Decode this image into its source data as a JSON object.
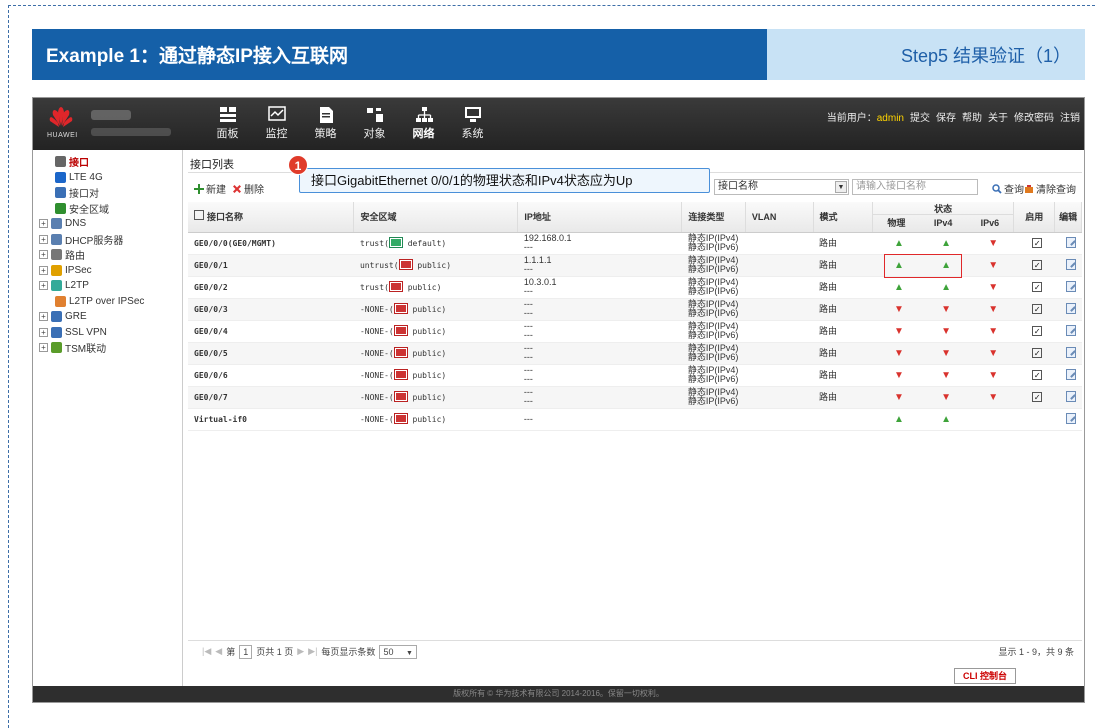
{
  "banner": {
    "title": "Example 1：通过静态IP接入互联网",
    "step": "Step5 结果验证（1）"
  },
  "app": {
    "brand": "HUAWEI",
    "nav": [
      {
        "label": "面板",
        "icon": "dashboard-icon"
      },
      {
        "label": "监控",
        "icon": "monitor-icon"
      },
      {
        "label": "策略",
        "icon": "policy-icon"
      },
      {
        "label": "对象",
        "icon": "object-icon"
      },
      {
        "label": "网络",
        "icon": "network-icon"
      },
      {
        "label": "系统",
        "icon": "system-icon"
      }
    ],
    "toplinks": {
      "user_prefix": "当前用户：",
      "user": "admin",
      "submit": "提交",
      "save": "保存",
      "help": "帮助",
      "about": "关于",
      "change_password": "修改密码",
      "logout": "注销"
    },
    "sidebar": [
      {
        "label": "接口",
        "active": true,
        "expand": false
      },
      {
        "label": "LTE 4G",
        "active": false,
        "expand": false
      },
      {
        "label": "接口对",
        "active": false,
        "expand": false
      },
      {
        "label": "安全区域",
        "active": false,
        "expand": false
      },
      {
        "label": "DNS",
        "active": false,
        "expand": true
      },
      {
        "label": "DHCP服务器",
        "active": false,
        "expand": true
      },
      {
        "label": "路由",
        "active": false,
        "expand": true
      },
      {
        "label": "IPSec",
        "active": false,
        "expand": true
      },
      {
        "label": "L2TP",
        "active": false,
        "expand": true
      },
      {
        "label": "L2TP over IPSec",
        "active": false,
        "expand": false
      },
      {
        "label": "GRE",
        "active": false,
        "expand": true
      },
      {
        "label": "SSL VPN",
        "active": false,
        "expand": true
      },
      {
        "label": "TSM联动",
        "active": false,
        "expand": true
      }
    ],
    "panel_title": "接口列表",
    "toolbar": {
      "new": "新建",
      "delete": "删除",
      "select_value": "接口名称",
      "search_placeholder": "请输入接口名称",
      "query": "查询",
      "clear": "清除查询"
    },
    "callout": {
      "num": "1",
      "text": "接口GigabitEthernet 0/0/1的物理状态和IPv4状态应为Up"
    },
    "columns": {
      "name": "接口名称",
      "zone": "安全区域",
      "ip": "IP地址",
      "conn": "连接类型",
      "vlan": "VLAN",
      "mode": "模式",
      "status": "状态",
      "phys": "物理",
      "ipv4": "IPv4",
      "ipv6": "IPv6",
      "enable": "启用",
      "edit": "编辑"
    },
    "rows": [
      {
        "name": "GE0/0/0(GE0/MGMT)",
        "zone_a": "trust(",
        "zone_b": " default)",
        "zone_color": "green",
        "ip1": "192.168.0.1",
        "ip2": "---",
        "conn1": "静态IP(IPv4)",
        "conn2": "静态IP(IPv6)",
        "mode": "路由",
        "phys": "up",
        "ipv4": "up",
        "ipv6": "down",
        "enable": true
      },
      {
        "name": "GE0/0/1",
        "zone_a": "untrust(",
        "zone_b": " public)",
        "zone_color": "red",
        "ip1": "1.1.1.1",
        "ip2": "---",
        "conn1": "静态IP(IPv4)",
        "conn2": "静态IP(IPv6)",
        "mode": "路由",
        "phys": "up",
        "ipv4": "up",
        "ipv6": "down",
        "enable": true
      },
      {
        "name": "GE0/0/2",
        "zone_a": "trust(",
        "zone_b": " public)",
        "zone_color": "red",
        "ip1": "10.3.0.1",
        "ip2": "---",
        "conn1": "静态IP(IPv4)",
        "conn2": "静态IP(IPv6)",
        "mode": "路由",
        "phys": "up",
        "ipv4": "up",
        "ipv6": "down",
        "enable": true
      },
      {
        "name": "GE0/0/3",
        "zone_a": "-NONE-(",
        "zone_b": " public)",
        "zone_color": "red",
        "ip1": "---",
        "ip2": "---",
        "conn1": "静态IP(IPv4)",
        "conn2": "静态IP(IPv6)",
        "mode": "路由",
        "phys": "down",
        "ipv4": "down",
        "ipv6": "down",
        "enable": true
      },
      {
        "name": "GE0/0/4",
        "zone_a": "-NONE-(",
        "zone_b": " public)",
        "zone_color": "red",
        "ip1": "---",
        "ip2": "---",
        "conn1": "静态IP(IPv4)",
        "conn2": "静态IP(IPv6)",
        "mode": "路由",
        "phys": "down",
        "ipv4": "down",
        "ipv6": "down",
        "enable": true
      },
      {
        "name": "GE0/0/5",
        "zone_a": "-NONE-(",
        "zone_b": " public)",
        "zone_color": "red",
        "ip1": "---",
        "ip2": "---",
        "conn1": "静态IP(IPv4)",
        "conn2": "静态IP(IPv6)",
        "mode": "路由",
        "phys": "down",
        "ipv4": "down",
        "ipv6": "down",
        "enable": true
      },
      {
        "name": "GE0/0/6",
        "zone_a": "-NONE-(",
        "zone_b": " public)",
        "zone_color": "red",
        "ip1": "---",
        "ip2": "---",
        "conn1": "静态IP(IPv4)",
        "conn2": "静态IP(IPv6)",
        "mode": "路由",
        "phys": "down",
        "ipv4": "down",
        "ipv6": "down",
        "enable": true
      },
      {
        "name": "GE0/0/7",
        "zone_a": "-NONE-(",
        "zone_b": " public)",
        "zone_color": "red",
        "ip1": "---",
        "ip2": "---",
        "conn1": "静态IP(IPv4)",
        "conn2": "静态IP(IPv6)",
        "mode": "路由",
        "phys": "down",
        "ipv4": "down",
        "ipv6": "down",
        "enable": true
      },
      {
        "name": "Virtual-if0",
        "zone_a": "-NONE-(",
        "zone_b": " public)",
        "zone_color": "red",
        "ip1": "---",
        "ip2": "",
        "conn1": "",
        "conn2": "",
        "mode": "",
        "phys": "up",
        "ipv4": "up",
        "ipv6": "",
        "enable": false
      }
    ],
    "pager": {
      "page_label": "第",
      "page_value": "1",
      "total_pages": "页共 1 页",
      "per_page_label": "每页显示条数",
      "per_page_value": "50",
      "summary": "显示 1 - 9，共 9 条"
    },
    "cli": "CLI 控制台",
    "footer": "版权所有 © 华为技术有限公司 2014-2016。保留一切权利。"
  }
}
